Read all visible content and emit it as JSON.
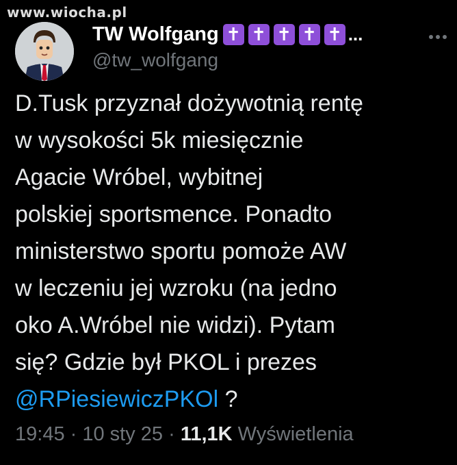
{
  "watermark": "www.wiocha.pl",
  "author": {
    "display_name": "TW Wolfgang",
    "badges": [
      "✝",
      "✝",
      "✝",
      "✝",
      "✝"
    ],
    "truncation": "...",
    "handle": "@tw_wolfgang",
    "badge_color": "#8e4fd9"
  },
  "tweet": {
    "lines": [
      "D.Tusk przyznał dożywotnią rentę",
      "w wysokości 5k miesięcznie",
      "Agacie Wróbel, wybitnej",
      "polskiej sportsmence. Ponadto",
      "ministerstwo sportu pomoże AW",
      "w leczeniu jej wzroku (na jedno",
      "oko A.Wróbel nie widzi). Pytam",
      "się? Gdzie był PKOL  i prezes"
    ],
    "mention": "@RPiesiewiczPKOl",
    "after_mention": " ?"
  },
  "meta": {
    "time": "19:45",
    "separator": " · ",
    "date": "10 sty 25",
    "views_count": "11,1K",
    "views_label": " Wyświetlenia"
  },
  "colors": {
    "background": "#000000",
    "text": "#e7e9ea",
    "secondary": "#71767b",
    "link": "#1d9bf0"
  }
}
